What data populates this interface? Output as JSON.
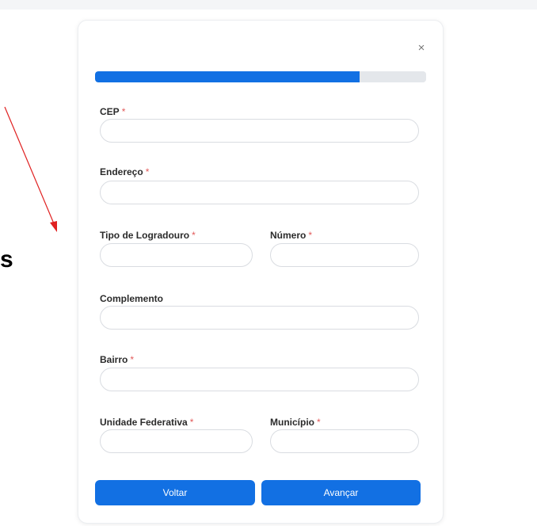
{
  "annotation": {
    "stray_text": "s"
  },
  "modal": {
    "close_label": "×",
    "progress_percent": 80,
    "fields": {
      "cep": {
        "label": "CEP",
        "required_mark": "*",
        "value": ""
      },
      "endereco": {
        "label": "Endereço",
        "required_mark": "*",
        "value": ""
      },
      "tipo_logradouro": {
        "label": "Tipo de Logradouro",
        "required_mark": "*",
        "value": ""
      },
      "numero": {
        "label": "Número",
        "required_mark": "*",
        "value": ""
      },
      "complemento": {
        "label": "Complemento",
        "value": ""
      },
      "bairro": {
        "label": "Bairro",
        "required_mark": "*",
        "value": ""
      },
      "uf": {
        "label": "Unidade Federativa",
        "required_mark": "*",
        "value": ""
      },
      "municipio": {
        "label": "Município",
        "required_mark": "*",
        "value": ""
      }
    },
    "buttons": {
      "back_label": "Voltar",
      "next_label": "Avançar"
    },
    "colors": {
      "primary": "#1270e3",
      "track": "#e4e7eb",
      "required": "#e25a5a",
      "annotation_arrow": "#e02020"
    }
  }
}
